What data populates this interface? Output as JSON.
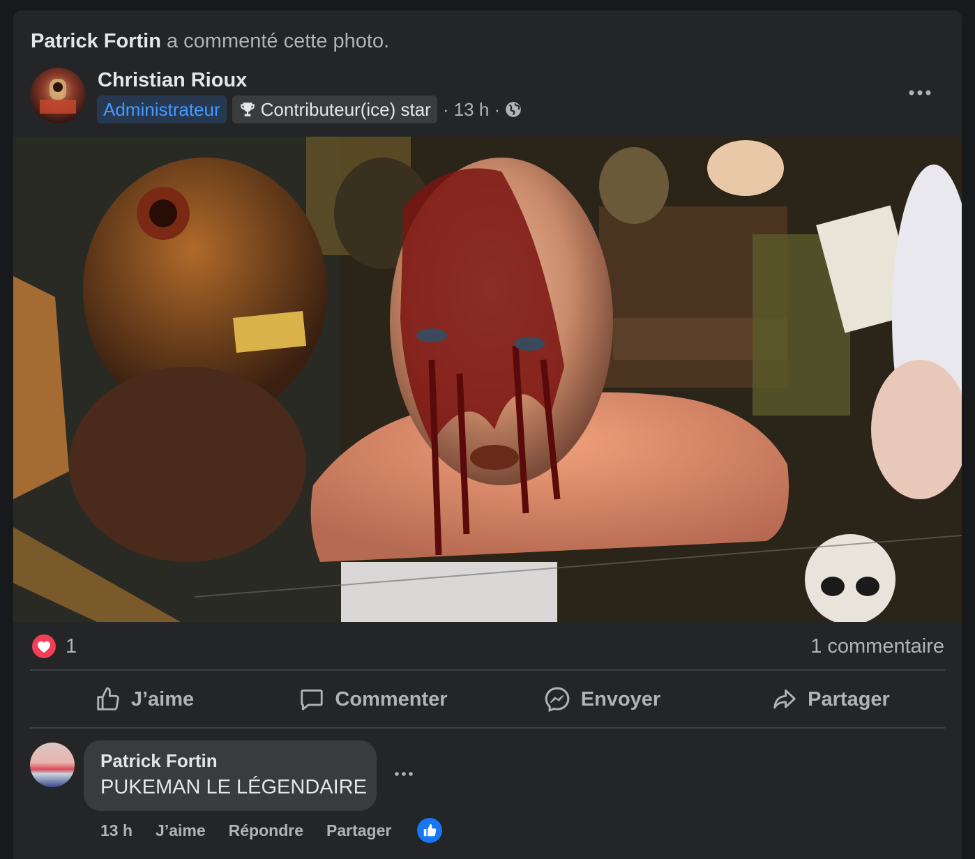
{
  "activity": {
    "actor": "Patrick Fortin",
    "text": " a commenté cette photo."
  },
  "post": {
    "author": "Christian Rioux",
    "badges": {
      "admin": "Administrateur",
      "star": "Contributeur(ice) star"
    },
    "time": "· 13 h ·",
    "audience_icon": "globe-icon"
  },
  "stats": {
    "reaction_count": "1",
    "reaction_icon": "heart-icon",
    "comments": "1 commentaire"
  },
  "actions": {
    "like": "J’aime",
    "comment": "Commenter",
    "send": "Envoyer",
    "share": "Partager"
  },
  "comment": {
    "author": "Patrick Fortin",
    "text": "PUKEMAN LE LÉGENDAIRE",
    "time": "13 h",
    "like": "J’aime",
    "reply": "Répondre",
    "share": "Partager"
  },
  "colors": {
    "accent": "#1877f2",
    "heart": "#f33e58",
    "admin_badge_text": "#4599ff",
    "card": "#242526"
  }
}
